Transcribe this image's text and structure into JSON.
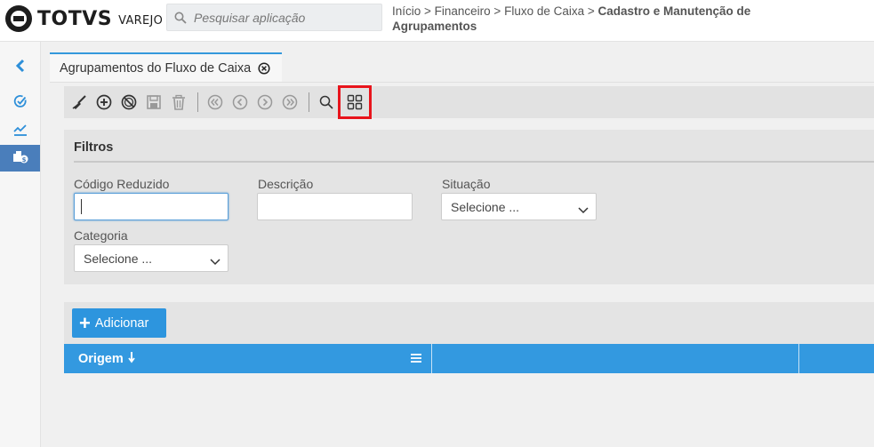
{
  "app": {
    "brand": "TOTVS",
    "product": "VAREJO"
  },
  "search": {
    "placeholder": "Pesquisar aplicação"
  },
  "breadcrumb": {
    "path": "Início > Financeiro > Fluxo de Caixa > ",
    "current": "Cadastro e Manutenção de Agrupamentos"
  },
  "sidebar": {
    "items": [
      {
        "icon": "chevron-left-icon"
      },
      {
        "icon": "check-circle-icon"
      },
      {
        "icon": "chart-line-icon"
      },
      {
        "icon": "cashflow-icon",
        "active": true
      }
    ]
  },
  "tab": {
    "label": "Agrupamentos do Fluxo de Caixa"
  },
  "toolbar": {
    "buttons": [
      "clear-icon",
      "add-circle-icon",
      "cancel-icon",
      "save-icon",
      "delete-icon",
      "first-icon",
      "previous-icon",
      "next-icon",
      "last-icon",
      "search-icon",
      "grid-view-icon"
    ]
  },
  "filters": {
    "title": "Filtros",
    "codigo_label": "Código Reduzido",
    "codigo_value": "",
    "descricao_label": "Descrição",
    "descricao_value": "",
    "situacao_label": "Situação",
    "situacao_value": "Selecione ...",
    "categoria_label": "Categoria",
    "categoria_value": "Selecione ..."
  },
  "actions": {
    "add_label": "Adicionar"
  },
  "grid": {
    "columns": [
      {
        "label": "Origem",
        "sort": "desc"
      },
      {
        "label": ""
      },
      {
        "label": ""
      }
    ]
  },
  "colors": {
    "accent": "#3399e0",
    "highlight": "#e8141c",
    "rail_active": "#4a7ebb"
  }
}
